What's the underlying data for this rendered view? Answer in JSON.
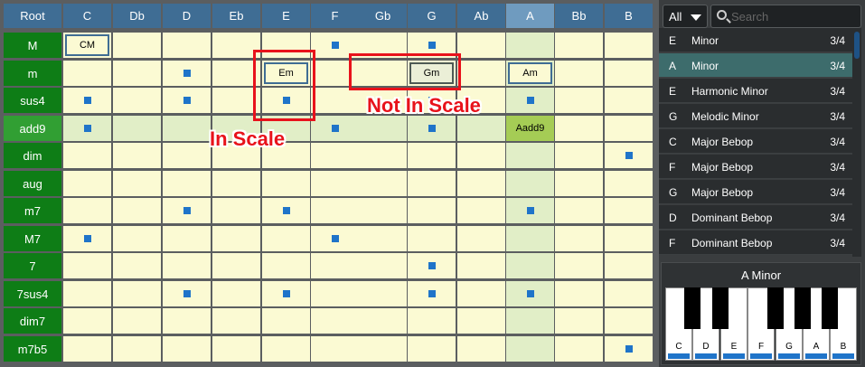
{
  "grid": {
    "corner_label": "Root",
    "columns": [
      "C",
      "Db",
      "D",
      "Eb",
      "E",
      "F",
      "Gb",
      "G",
      "Ab",
      "A",
      "Bb",
      "B"
    ],
    "selected_column": "A",
    "selected_row": "add9",
    "rows": [
      {
        "label": "M",
        "cells": [
          {
            "chord": "CM",
            "style": "inscale"
          },
          "",
          "",
          " ",
          "",
          "dot",
          "",
          "dot",
          "",
          "hl",
          "",
          ""
        ]
      },
      {
        "label": "m",
        "cells": [
          "",
          "",
          "dot",
          "",
          {
            "chord": "Em",
            "style": "inscale"
          },
          "",
          "",
          {
            "chord": "Gm",
            "style": "notin"
          },
          "",
          {
            "chord": "Am",
            "style": "inscale"
          },
          "",
          ""
        ]
      },
      {
        "label": "sus4",
        "cells": [
          "dot",
          "",
          "dot",
          "",
          "dot",
          "",
          "",
          "dot",
          "",
          "dot",
          "",
          ""
        ]
      },
      {
        "label": "add9",
        "cells": [
          "dot",
          "hl",
          "hl",
          "hl",
          "hl",
          "dot",
          "hl",
          "dot",
          "hl",
          {
            "chord": "Aadd9",
            "style": "fill"
          },
          "",
          ""
        ]
      },
      {
        "label": "dim",
        "cells": [
          "",
          "",
          "",
          "",
          "",
          "",
          "",
          "",
          "",
          "",
          "",
          "dot"
        ]
      },
      {
        "label": "aug",
        "cells": [
          "",
          "",
          "",
          "",
          "",
          "",
          "",
          "",
          "",
          "",
          "",
          ""
        ]
      },
      {
        "label": "m7",
        "cells": [
          "",
          "",
          "dot",
          "",
          "dot",
          "",
          "",
          "",
          "",
          "dot",
          "",
          ""
        ]
      },
      {
        "label": "M7",
        "cells": [
          "dot",
          "",
          "",
          "",
          "",
          "dot",
          "",
          "",
          "",
          "",
          "",
          ""
        ]
      },
      {
        "label": "7",
        "cells": [
          "",
          "",
          "",
          "",
          "",
          "",
          "",
          "dot",
          "",
          "",
          "",
          ""
        ]
      },
      {
        "label": "7sus4",
        "cells": [
          "",
          "",
          "dot",
          "",
          "dot",
          "",
          "",
          "dot",
          "",
          "dot",
          "",
          ""
        ]
      },
      {
        "label": "dim7",
        "cells": [
          "",
          "",
          "",
          "",
          "",
          "",
          "",
          "",
          "",
          "",
          "",
          ""
        ]
      },
      {
        "label": "m7b5",
        "cells": [
          "",
          "",
          "",
          "",
          "",
          "",
          "",
          "",
          "",
          "",
          "",
          "dot"
        ]
      }
    ]
  },
  "annotations": {
    "in_scale": "In Scale",
    "not_in_scale": "Not In Scale"
  },
  "filter": {
    "value": "All"
  },
  "search": {
    "placeholder": "Search"
  },
  "scales": [
    {
      "root": "E",
      "name": "Minor",
      "count": "3/4"
    },
    {
      "root": "A",
      "name": "Minor",
      "count": "3/4",
      "selected": true
    },
    {
      "root": "E",
      "name": "Harmonic Minor",
      "count": "3/4"
    },
    {
      "root": "G",
      "name": "Melodic Minor",
      "count": "3/4"
    },
    {
      "root": "C",
      "name": "Major Bebop",
      "count": "3/4"
    },
    {
      "root": "F",
      "name": "Major Bebop",
      "count": "3/4"
    },
    {
      "root": "G",
      "name": "Major Bebop",
      "count": "3/4"
    },
    {
      "root": "D",
      "name": "Dominant Bebop",
      "count": "3/4"
    },
    {
      "root": "F",
      "name": "Dominant Bebop",
      "count": "3/4"
    }
  ],
  "piano": {
    "title": "A Minor",
    "white_keys": [
      "C",
      "D",
      "E",
      "F",
      "G",
      "A",
      "B"
    ]
  },
  "colors": {
    "header": "#3f6d94",
    "root_column": "#0e7d16",
    "dot": "#1f74c9",
    "annotation": "#e8121b",
    "chord_fill": "#a5cc55"
  }
}
